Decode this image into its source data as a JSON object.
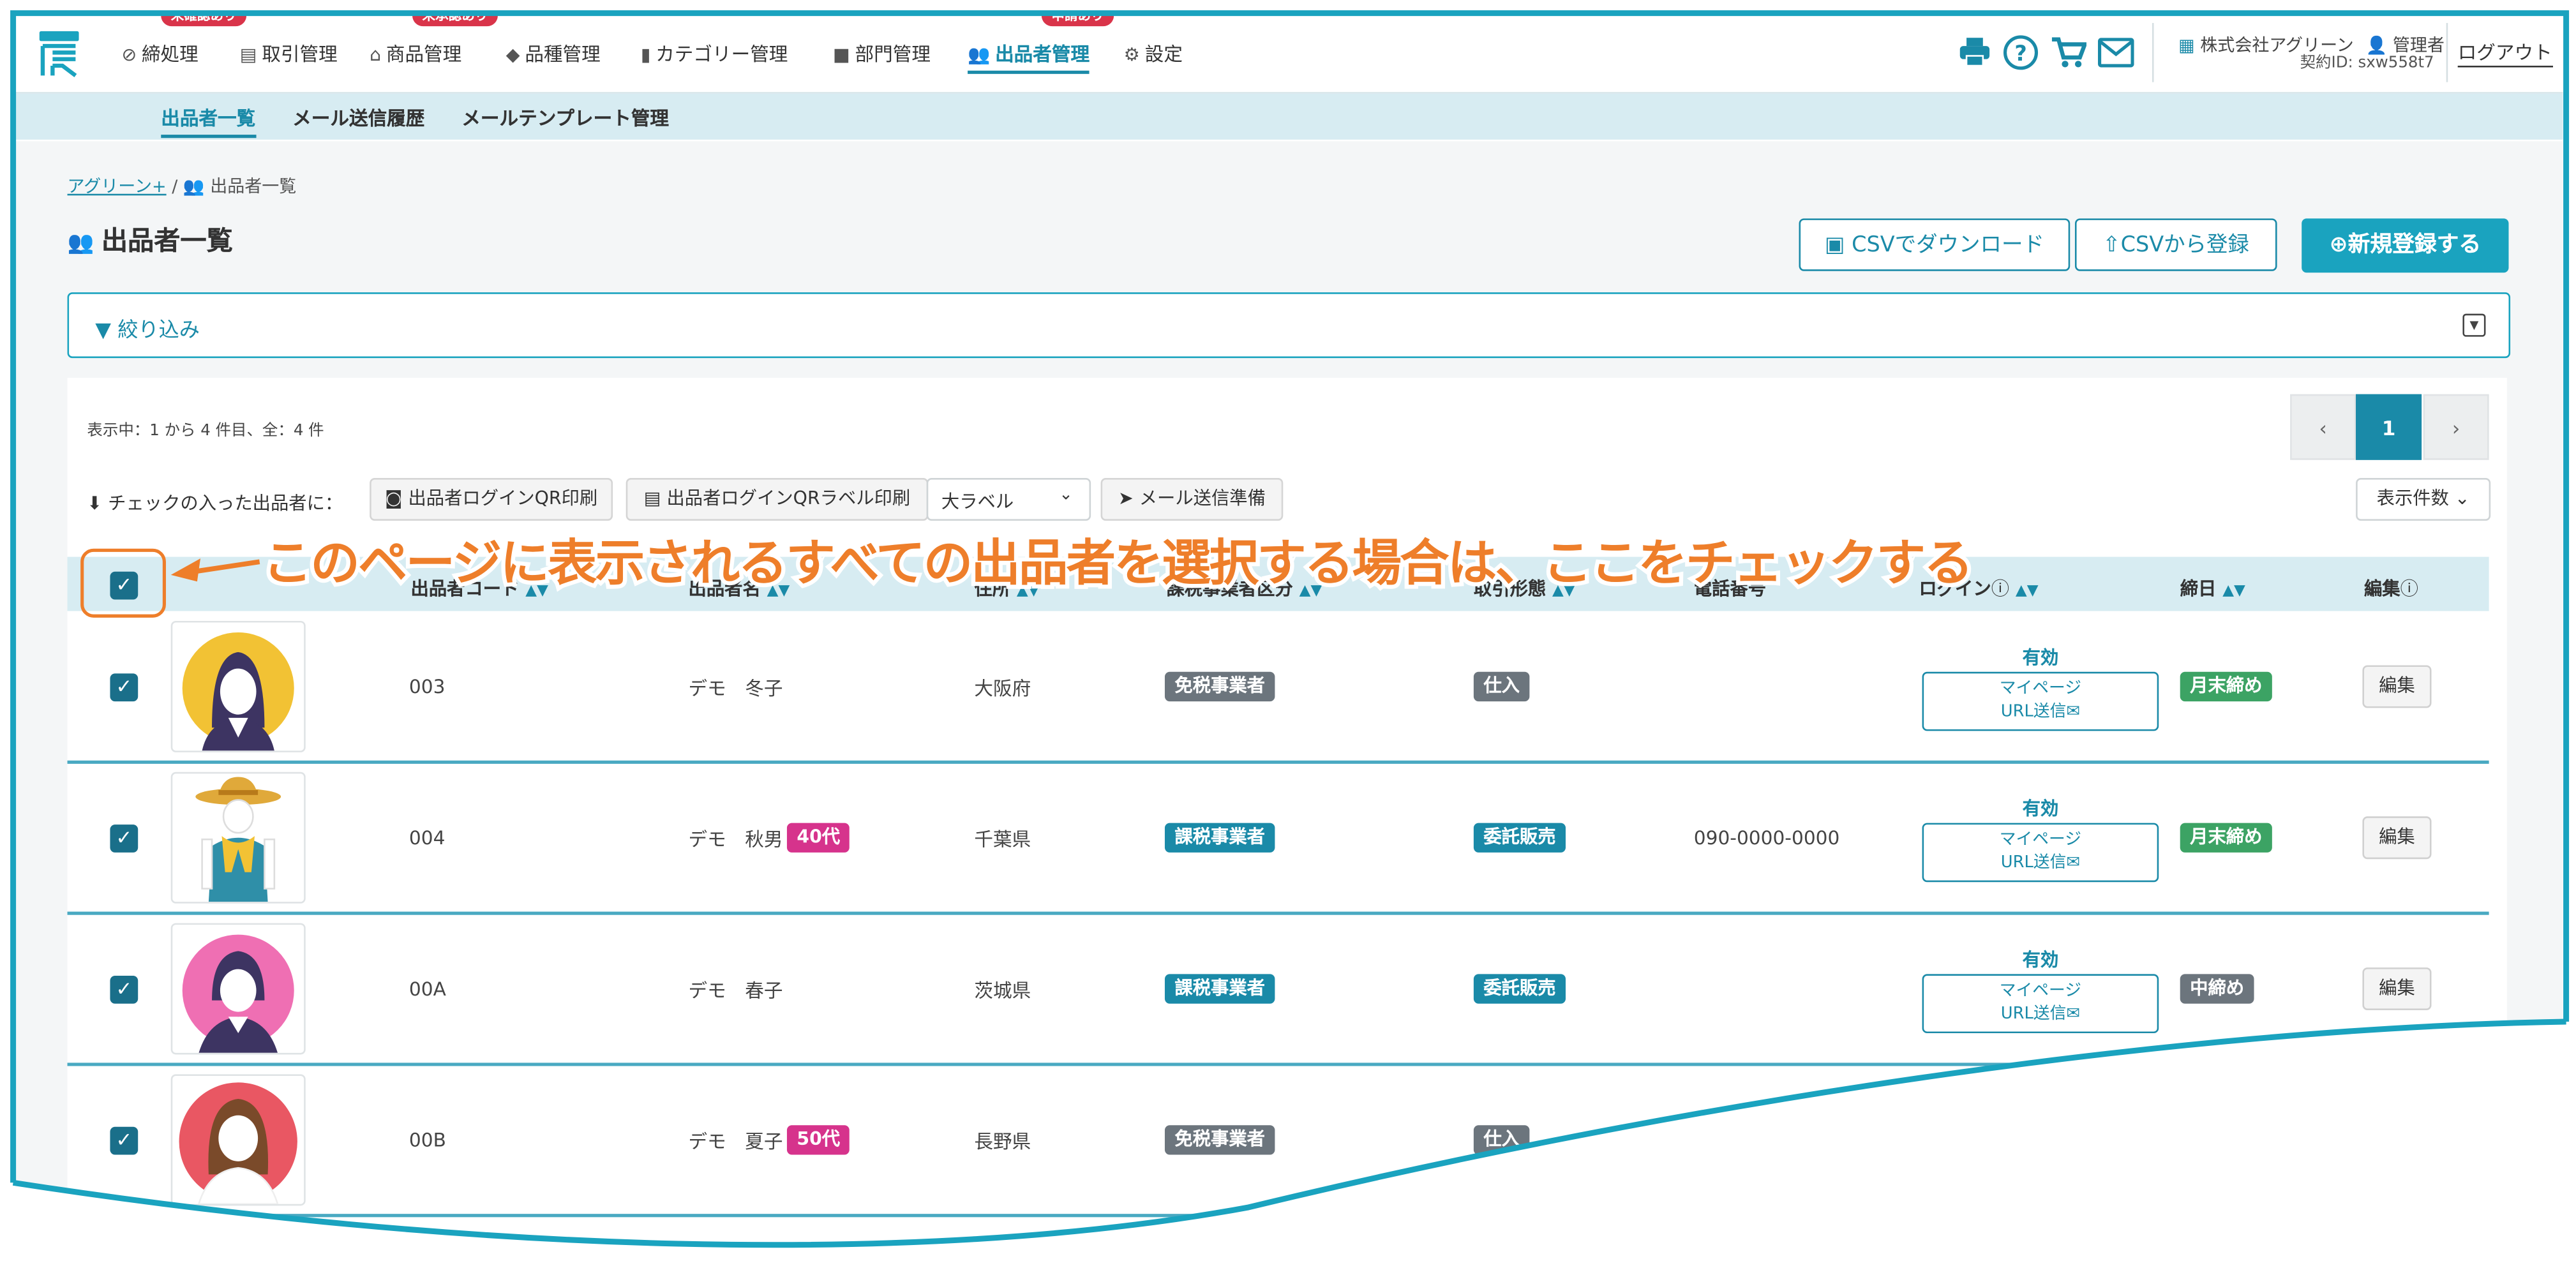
{
  "header": {
    "nav": [
      {
        "label": "締処理",
        "icon": "check-circle-icon",
        "badge": "未確認あり"
      },
      {
        "label": "取引管理",
        "icon": "list-icon",
        "badge": ""
      },
      {
        "label": "商品管理",
        "icon": "basket-icon",
        "badge": "未承認あり"
      },
      {
        "label": "品種管理",
        "icon": "tag-icon",
        "badge": ""
      },
      {
        "label": "カテゴリー管理",
        "icon": "book-icon",
        "badge": ""
      },
      {
        "label": "部門管理",
        "icon": "folder-icon",
        "badge": ""
      },
      {
        "label": "出品者管理",
        "icon": "users-icon",
        "badge": "申請あり"
      },
      {
        "label": "設定",
        "icon": "gear-icon",
        "badge": ""
      }
    ],
    "company": "株式会社アグリーン",
    "role": "管理者",
    "contract": "契約ID: sxw558t7",
    "logout": "ログアウト"
  },
  "subnav": [
    "出品者一覧",
    "メール送信履歴",
    "メールテンプレート管理"
  ],
  "breadcrumb": {
    "home": "アグリーン+",
    "current": "出品者一覧"
  },
  "page": {
    "title": "出品者一覧",
    "csv_download": "CSVでダウンロード",
    "csv_register": "CSVから登録",
    "new_register": "新規登録する",
    "filter": "絞り込み"
  },
  "list": {
    "count_text": "表示中：1 から 4 件目、全：4 件",
    "pager": {
      "prev": "‹",
      "current": "1",
      "next": "›"
    },
    "bulk_label": "チェックの入った出品者に：",
    "qr_print": "出品者ログインQR印刷",
    "qr_label_print": "出品者ログインQRラベル印刷",
    "label_size": "大ラベル",
    "mail_prepare": "メール送信準備",
    "per_page": "表示件数"
  },
  "table": {
    "columns": [
      "出品者コード",
      "出品者名",
      "住所",
      "課税事業者区分",
      "取引形態",
      "電話番号",
      "ログイン",
      "締日",
      "編集"
    ],
    "rows": [
      {
        "code": "003",
        "name": "デモ　冬子",
        "age": "",
        "address": "大阪府",
        "tax": "免税事業者",
        "tax_color": "gray",
        "trade": "仕入",
        "trade_color": "gray",
        "phone": "",
        "login": "有効",
        "mypage": "マイページ",
        "url_send": "URL送信",
        "close": "月末締め",
        "close_color": "green",
        "edit": "編集"
      },
      {
        "code": "004",
        "name": "デモ　秋男",
        "age": "40代",
        "address": "千葉県",
        "tax": "課税事業者",
        "tax_color": "teal",
        "trade": "委託販売",
        "trade_color": "teal",
        "phone": "090-0000-0000",
        "login": "有効",
        "mypage": "マイページ",
        "url_send": "URL送信",
        "close": "月末締め",
        "close_color": "green",
        "edit": "編集"
      },
      {
        "code": "00A",
        "name": "デモ　春子",
        "age": "",
        "address": "茨城県",
        "tax": "課税事業者",
        "tax_color": "teal",
        "trade": "委託販売",
        "trade_color": "teal",
        "phone": "",
        "login": "有効",
        "mypage": "マイページ",
        "url_send": "URL送信",
        "close": "中締め",
        "close_color": "gray",
        "edit": "編集"
      },
      {
        "code": "00B",
        "name": "デモ　夏子",
        "age": "50代",
        "address": "長野県",
        "tax": "免税事業者",
        "tax_color": "gray",
        "trade": "仕入",
        "trade_color": "gray",
        "phone": "",
        "login": "",
        "mypage": "",
        "url_send": "",
        "close": "",
        "close_color": "",
        "edit": ""
      }
    ]
  },
  "annotation": "このページに表示されるすべての出品者を選択する場合は、ここをチェックする",
  "colors": {
    "accent": "#1a8aa8",
    "annotation": "#ee7e2a",
    "frame": "#1aa3bf"
  }
}
